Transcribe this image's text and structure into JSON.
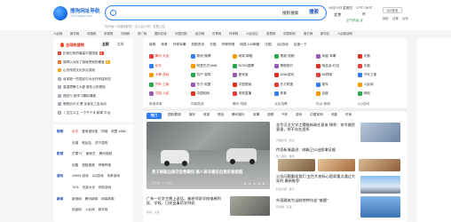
{
  "logo": {
    "title": "搜狗网址导航",
    "url": "123.sogou.com"
  },
  "search": {
    "engine": "搜狗搜索",
    "button": "搜索",
    "hint": "你的每一次搜索都是一次公益行动！查看公益"
  },
  "weather": {
    "date": "09月19日 星期四",
    "city": "北京",
    "temp": "17℃~26℃",
    "condition": "晴",
    "aqi": "空气质量 优"
  },
  "account": {
    "login": "QQ登录",
    "links": [
      "换肤",
      "设置",
      "反馈"
    ]
  },
  "quick_links": [
    "人民网",
    "新华网",
    "中国网",
    "央视网",
    "光明网",
    "央广网",
    "国际在线",
    "中国日报",
    "经济网",
    "中青网",
    "环球网",
    "人民论坛",
    "求是网",
    "中国军网",
    "南方网",
    "新华社",
    "人民政协网"
  ],
  "hot": {
    "title": "全网热搜榜",
    "tabs": [
      "全网",
      "实时"
    ],
    "items": [
      {
        "rank": "1",
        "text": "拍卖出来的最高中国国宝",
        "tag": "热",
        "tag_color": "#e0301e"
      },
      {
        "rank": "2",
        "text": "故障以为除了她就把他的硬盘",
        "tag": "新",
        "tag_color": "#f59b00"
      },
      {
        "rank": "3",
        "text": "山东传统文化多点突破",
        "tag": "",
        "tag_color": ""
      },
      {
        "rank": "4",
        "text": "台军被一些居民中大比作安保状态",
        "tag": "",
        "tag_color": ""
      },
      {
        "rank": "5",
        "text": "高温预警江大夏 夏伦公的规矩",
        "tag": "",
        "tag_color": ""
      },
      {
        "rank": "6",
        "text": "德宏兴 西学习模拟课程",
        "tag": "",
        "tag_color": ""
      },
      {
        "rank": "7",
        "text": "暗夜迈卢泛 是 全省化工全活动",
        "tag": "",
        "tag_color": ""
      },
      {
        "rank": "8",
        "text": "丨生拉斗主 一个千个手 新闻 平台",
        "tag": "",
        "tag_color": ""
      }
    ]
  },
  "categories": [
    {
      "key": "购物",
      "items": [
        "京东",
        "爱淘宝特惠",
        "同城",
        "阿里 1688"
      ]
    },
    {
      "key": "",
      "items": [
        "天猫",
        "唯品会",
        "苏宁易购"
      ]
    },
    {
      "key": "影视",
      "items": [
        "芒果TV",
        "爱奇艺",
        "腾讯视频"
      ]
    },
    {
      "key": "",
      "items": [
        "优酷",
        "搜狐视频",
        "哔哩哔哩"
      ]
    },
    {
      "key": "游戏",
      "items": [
        "4399小游戏",
        "QQ游戏",
        "传奇游戏"
      ]
    },
    {
      "key": "",
      "items": [
        "7k7k",
        "页游大全",
        "网页游戏"
      ]
    },
    {
      "key": "新闻",
      "items": [
        "新浪网",
        "腾讯新闻",
        "网易新闻"
      ]
    },
    {
      "key": "",
      "items": [
        "凤凰网",
        "人民网",
        "新华网"
      ]
    }
  ],
  "nav_top": [
    "新闻",
    "体育",
    "环球军事",
    "热剧资讯",
    "天猫",
    "哔哩哔哩",
    "网易 163邮箱",
    "中国",
    "QQ游戏",
    "百度一下"
  ],
  "nav_rows": [
    [
      "腾讯·天龙",
      "新浪·微博",
      "网易·邮箱",
      "搜狐·视频",
      "凤凰·军事",
      "天猫"
    ],
    [
      "京东",
      "阿里巴巴1688",
      "BOSS直聘",
      "携程旅行",
      "唯品会·红包",
      "天猫"
    ],
    [
      "卡牌·游戏",
      "苏宁·易购",
      "爱淘宝",
      "4366游戏",
      "58同城",
      "汽车之家"
    ],
    [
      "汽车·之家",
      "东方·财富",
      "中国搜索",
      "东方财富",
      "易车",
      "人民网"
    ],
    [
      "中国·人民",
      "中国知网",
      "电视直播",
      "体育",
      "百度",
      "网络"
    ]
  ],
  "nav_extra": [
    "新浪体育",
    "同城旅游",
    "腾讯·视频",
    "北京招聘",
    "热点·新闻",
    "QQ空间"
  ],
  "feed": {
    "tabs": [
      "热门",
      "国际要闻",
      "娱乐",
      "体育",
      "财经",
      "腾讯娱乐",
      "军事",
      "视频",
      "汽车",
      "游戏",
      "中国军网",
      "电影",
      "时尚"
    ],
    "headline": "男子被路边高空坠物砸伤 路人将车挪走后竟反被索赔",
    "headline_src": "新华网 · 2小时前",
    "headline_dots": "● ● ● ● ●",
    "news": [
      {
        "text": "金华汉文大学江鹰推新闻任意来 律师：命令救民意意，将不存在居所",
        "src": "界面新闻 · 热点"
      },
      {
        "text": "传奇新服逼进：邮箱卫公出图拿证据",
        "src": "热门游戏 · 推荐"
      },
      {
        "text": "公告问题重现我们 五色大校标心国家重点通过大家的 最新推荐",
        "src": "科技日报 · 官方"
      }
    ],
    "bottom": [
      {
        "text": "广东一位学生晚上说话，被老师说学校电梯到医、学校，已经出事药学例如",
        "src": "新闻 · 头条"
      },
      {
        "text": "外国建筑为当前特种作战 \"难题\"",
        "src": "环球网 · 军事"
      }
    ]
  },
  "colors": {
    "accent": "#2f7cf6",
    "hot": "#e0301e"
  }
}
